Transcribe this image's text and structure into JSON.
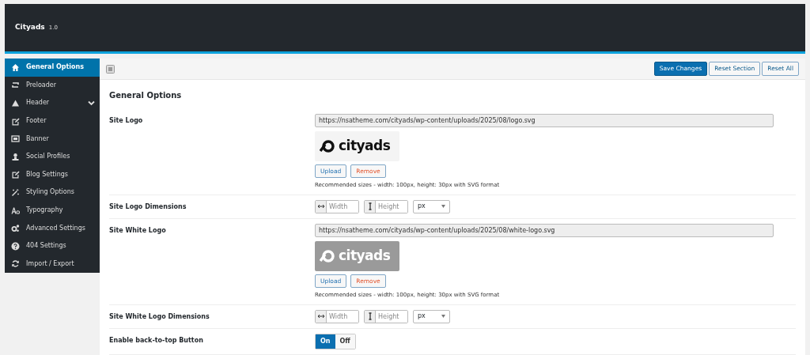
{
  "header": {
    "title": "Cityads",
    "version": "1.0"
  },
  "sidebar": {
    "items": [
      {
        "label": "General Options",
        "selected": true,
        "submenu": false
      },
      {
        "label": "Preloader",
        "selected": false,
        "submenu": false
      },
      {
        "label": "Header",
        "selected": false,
        "submenu": true
      },
      {
        "label": "Footer",
        "selected": false,
        "submenu": false
      },
      {
        "label": "Banner",
        "selected": false,
        "submenu": false
      },
      {
        "label": "Social Profiles",
        "selected": false,
        "submenu": false
      },
      {
        "label": "Blog Settings",
        "selected": false,
        "submenu": false
      },
      {
        "label": "Styling Options",
        "selected": false,
        "submenu": false
      },
      {
        "label": "Typography",
        "selected": false,
        "submenu": false
      },
      {
        "label": "Advanced Settings",
        "selected": false,
        "submenu": false
      },
      {
        "label": "404 Settings",
        "selected": false,
        "submenu": false
      },
      {
        "label": "Import / Export",
        "selected": false,
        "submenu": false
      }
    ]
  },
  "toolbar": {
    "buttons": [
      {
        "label": "Save Changes",
        "kind": "primary"
      },
      {
        "label": "Reset Section",
        "kind": "secondary"
      },
      {
        "label": "Reset All",
        "kind": "secondary"
      }
    ]
  },
  "section": {
    "title": "General Options",
    "rows": [
      {
        "kind": "media",
        "label": "Site Logo",
        "url": "https://nsatheme.com/cityads/wp-content/uploads/2025/08/logo.svg",
        "preview_text": "cityads",
        "inverted": false,
        "upload": "Upload",
        "remove": "Remove",
        "hint": "Recommended sizes - width: 100px, height: 30px with SVG format"
      },
      {
        "kind": "dimensions",
        "label": "Site Logo Dimensions",
        "width_placeholder": "Width",
        "height_placeholder": "Height",
        "unit": "px"
      },
      {
        "kind": "media",
        "label": "Site White Logo",
        "url": "https://nsatheme.com/cityads/wp-content/uploads/2025/08/white-logo.svg",
        "preview_text": "cityads",
        "inverted": true,
        "upload": "Upload",
        "remove": "Remove",
        "hint": "Recommended sizes - width: 100px, height: 30px with SVG format"
      },
      {
        "kind": "dimensions",
        "label": "Site White Logo Dimensions",
        "width_placeholder": "Width",
        "height_placeholder": "Height",
        "unit": "px"
      },
      {
        "kind": "toggle",
        "label": "Enable back-to-top Button",
        "options": [
          {
            "label": "On",
            "selected": true
          },
          {
            "label": "Off",
            "selected": false
          }
        ]
      }
    ]
  }
}
